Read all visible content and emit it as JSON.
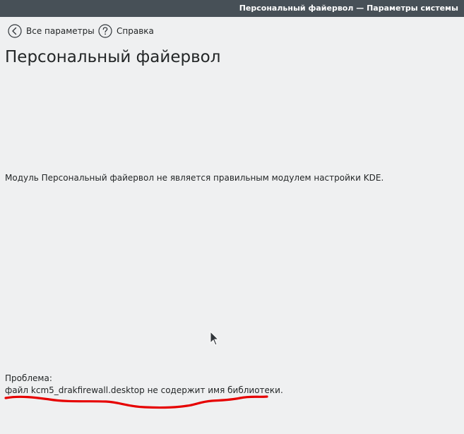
{
  "window": {
    "title": "Персональный файервол — Параметры системы"
  },
  "toolbar": {
    "back_label": "Все параметры",
    "help_label": "Справка"
  },
  "page": {
    "title": "Персональный файервол",
    "module_message": "Модуль Персональный файервол не является правильным модулем настройки KDE.",
    "problem_heading": "Проблема:",
    "problem_detail": "файл kcm5_drakfirewall.desktop не содержит имя библиотеки."
  },
  "icons": {
    "back": "back-arrow-circle-icon",
    "help": "help-question-circle-icon",
    "cursor": "mouse-pointer-icon"
  },
  "colors": {
    "titlebar_bg": "#475057",
    "titlebar_text": "#ffffff",
    "window_bg": "#eff0f1",
    "text": "#232627",
    "annotation": "#e60000"
  }
}
